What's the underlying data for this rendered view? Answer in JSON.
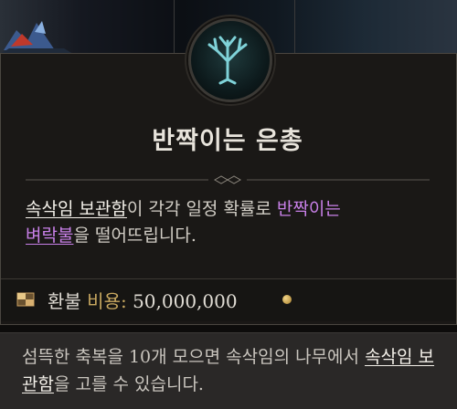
{
  "title": "반짝이는 은총",
  "description": {
    "part1": "속삭임 보관함",
    "part2": "이 각각 일정 확률로 ",
    "part3": "반짝이는",
    "part4": "벼락불",
    "part5": "을 떨어뜨립니다."
  },
  "cost": {
    "label": "환불 ",
    "gold_label": "비용:",
    "value": " 50,000,000"
  },
  "footer": {
    "part1": "섬뜩한 축복을 10개 모으면 속삭임의 나무에서 ",
    "part2": "속삭임 보관함",
    "part3": "을 고를 수 있습니다."
  },
  "icons": {
    "emblem": "tree-of-whispers-icon",
    "cost": "cache-chest-icon",
    "currency": "gold-coin-icon"
  },
  "colors": {
    "highlight_purple": "#c880e8",
    "gold": "#c8a860",
    "emblem_teal": "#7fd2d8"
  }
}
